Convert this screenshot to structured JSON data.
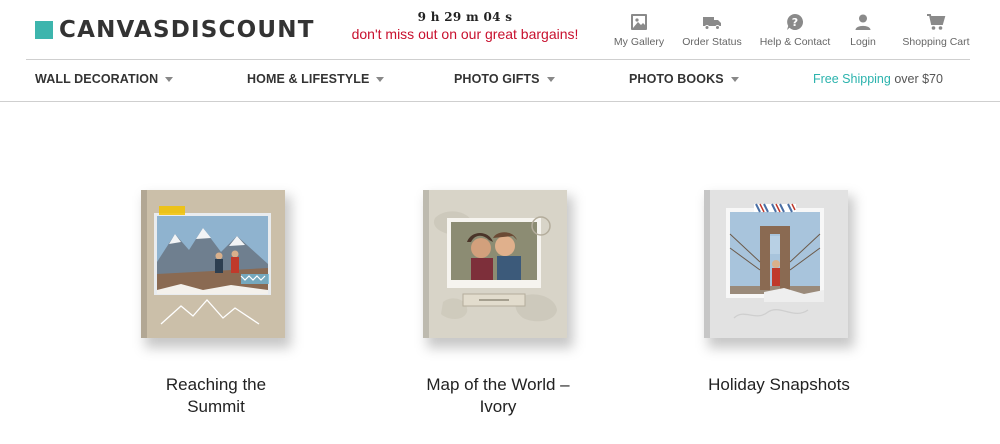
{
  "brand": {
    "name": "CANVASDISCOUNT",
    "accent_color": "#3db5ad"
  },
  "promo": {
    "countdown": "9 h 29 m 04 s",
    "message": "don't miss out on our great bargains!",
    "message_color": "#c8102e"
  },
  "tools": [
    {
      "label": "My Gallery",
      "icon": "gallery-icon"
    },
    {
      "label": "Order Status",
      "icon": "truck-icon"
    },
    {
      "label": "Help & Contact",
      "icon": "help-icon"
    },
    {
      "label": "Login",
      "icon": "user-icon"
    },
    {
      "label": "Shopping Cart",
      "icon": "cart-icon"
    }
  ],
  "nav": {
    "items": [
      {
        "label": "WALL DECORATION"
      },
      {
        "label": "HOME & LIFESTYLE"
      },
      {
        "label": "PHOTO GIFTS"
      },
      {
        "label": "PHOTO BOOKS"
      }
    ],
    "shipping": {
      "highlight": "Free Shipping",
      "rest": "over $70",
      "highlight_color": "#2bb3ad"
    }
  },
  "products": [
    {
      "title_line1": "Reaching the",
      "title_line2": "Summit"
    },
    {
      "title_line1": "Map of the World –",
      "title_line2": "Ivory"
    },
    {
      "title_line1": "Holiday Snapshots",
      "title_line2": ""
    }
  ]
}
